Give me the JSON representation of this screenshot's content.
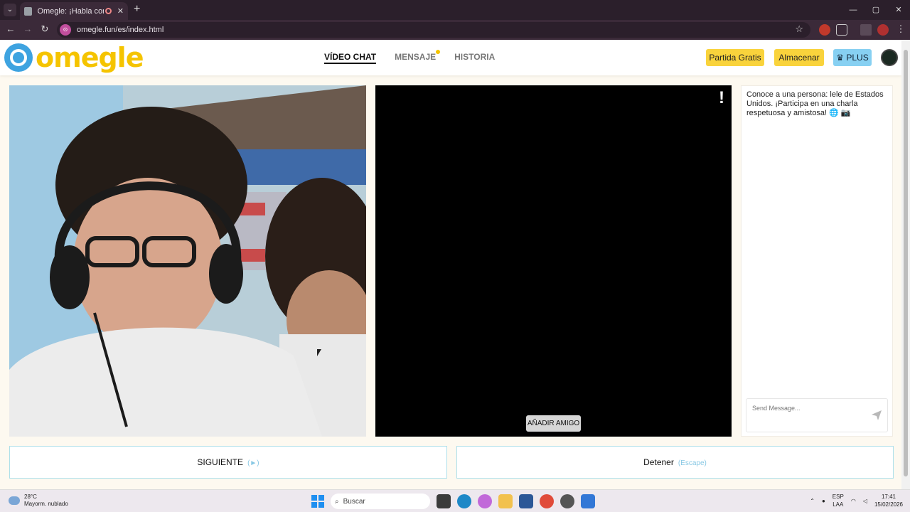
{
  "browser": {
    "tab_title": "Omegle: ¡Habla con Descon",
    "url": "omegle.fun/es/index.html",
    "new_tab_label": "+",
    "window_controls": [
      "—",
      "▢",
      "✕"
    ]
  },
  "site": {
    "logo_text": "omegle",
    "nav": {
      "video_chat": "VÍDEO CHAT",
      "mensaje": "MENSAJE",
      "historia": "HISTORIA"
    },
    "buttons": {
      "partida": "Partida Gratis",
      "almacenar": "Almacenar",
      "plus": "♛ PLUS"
    },
    "colors": {
      "brand_yellow": "#f5c400",
      "brand_blue": "#3ea3e0",
      "plus_blue": "#87d0f2"
    }
  },
  "video": {
    "report_label": "!",
    "add_friend": "AÑADIR AMIGO"
  },
  "chat": {
    "message": "Conoce a una persona: lele de Estados Unidos. ¡Participa en una charla respetuosa y amistosa! 🌐 📷",
    "input_placeholder": "Send Message..."
  },
  "controls": {
    "next_label": "SIGUIENTE",
    "next_hint": "(►)",
    "stop_label": "Detener",
    "stop_hint": "(Escape)"
  },
  "taskbar": {
    "temperature": "28°C",
    "weather": "Mayorm. nublado",
    "search_label": "Buscar",
    "lang_top": "ESP",
    "lang_bottom": "LAA",
    "time": "17:41",
    "date": "15/02/2026"
  }
}
